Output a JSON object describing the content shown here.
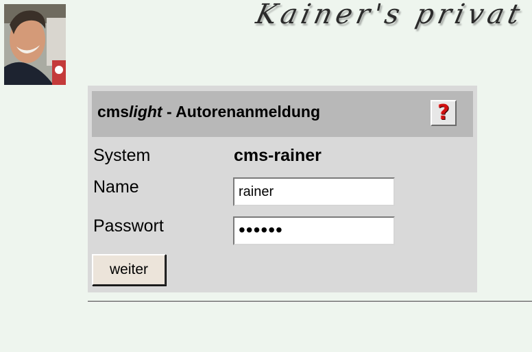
{
  "banner": {
    "text": "Kainer's privat"
  },
  "profile_photo": {
    "icon": "person-photo"
  },
  "login": {
    "title_prefix": "cms",
    "title_italic": "light",
    "title_suffix": " - Autorenanmeldung",
    "help_icon": "question-mark-icon",
    "help_symbol": "?",
    "system_label": "System",
    "system_value": "cms-rainer",
    "name_label": "Name",
    "name_value": "rainer",
    "password_label": "Passwort",
    "password_mask": "••••••",
    "submit_label": "weiter"
  },
  "colors": {
    "page_background": "#eef5ee",
    "box_background": "#d9d9d9",
    "header_background": "#b8b8b8",
    "help_icon_red": "#d01010"
  }
}
